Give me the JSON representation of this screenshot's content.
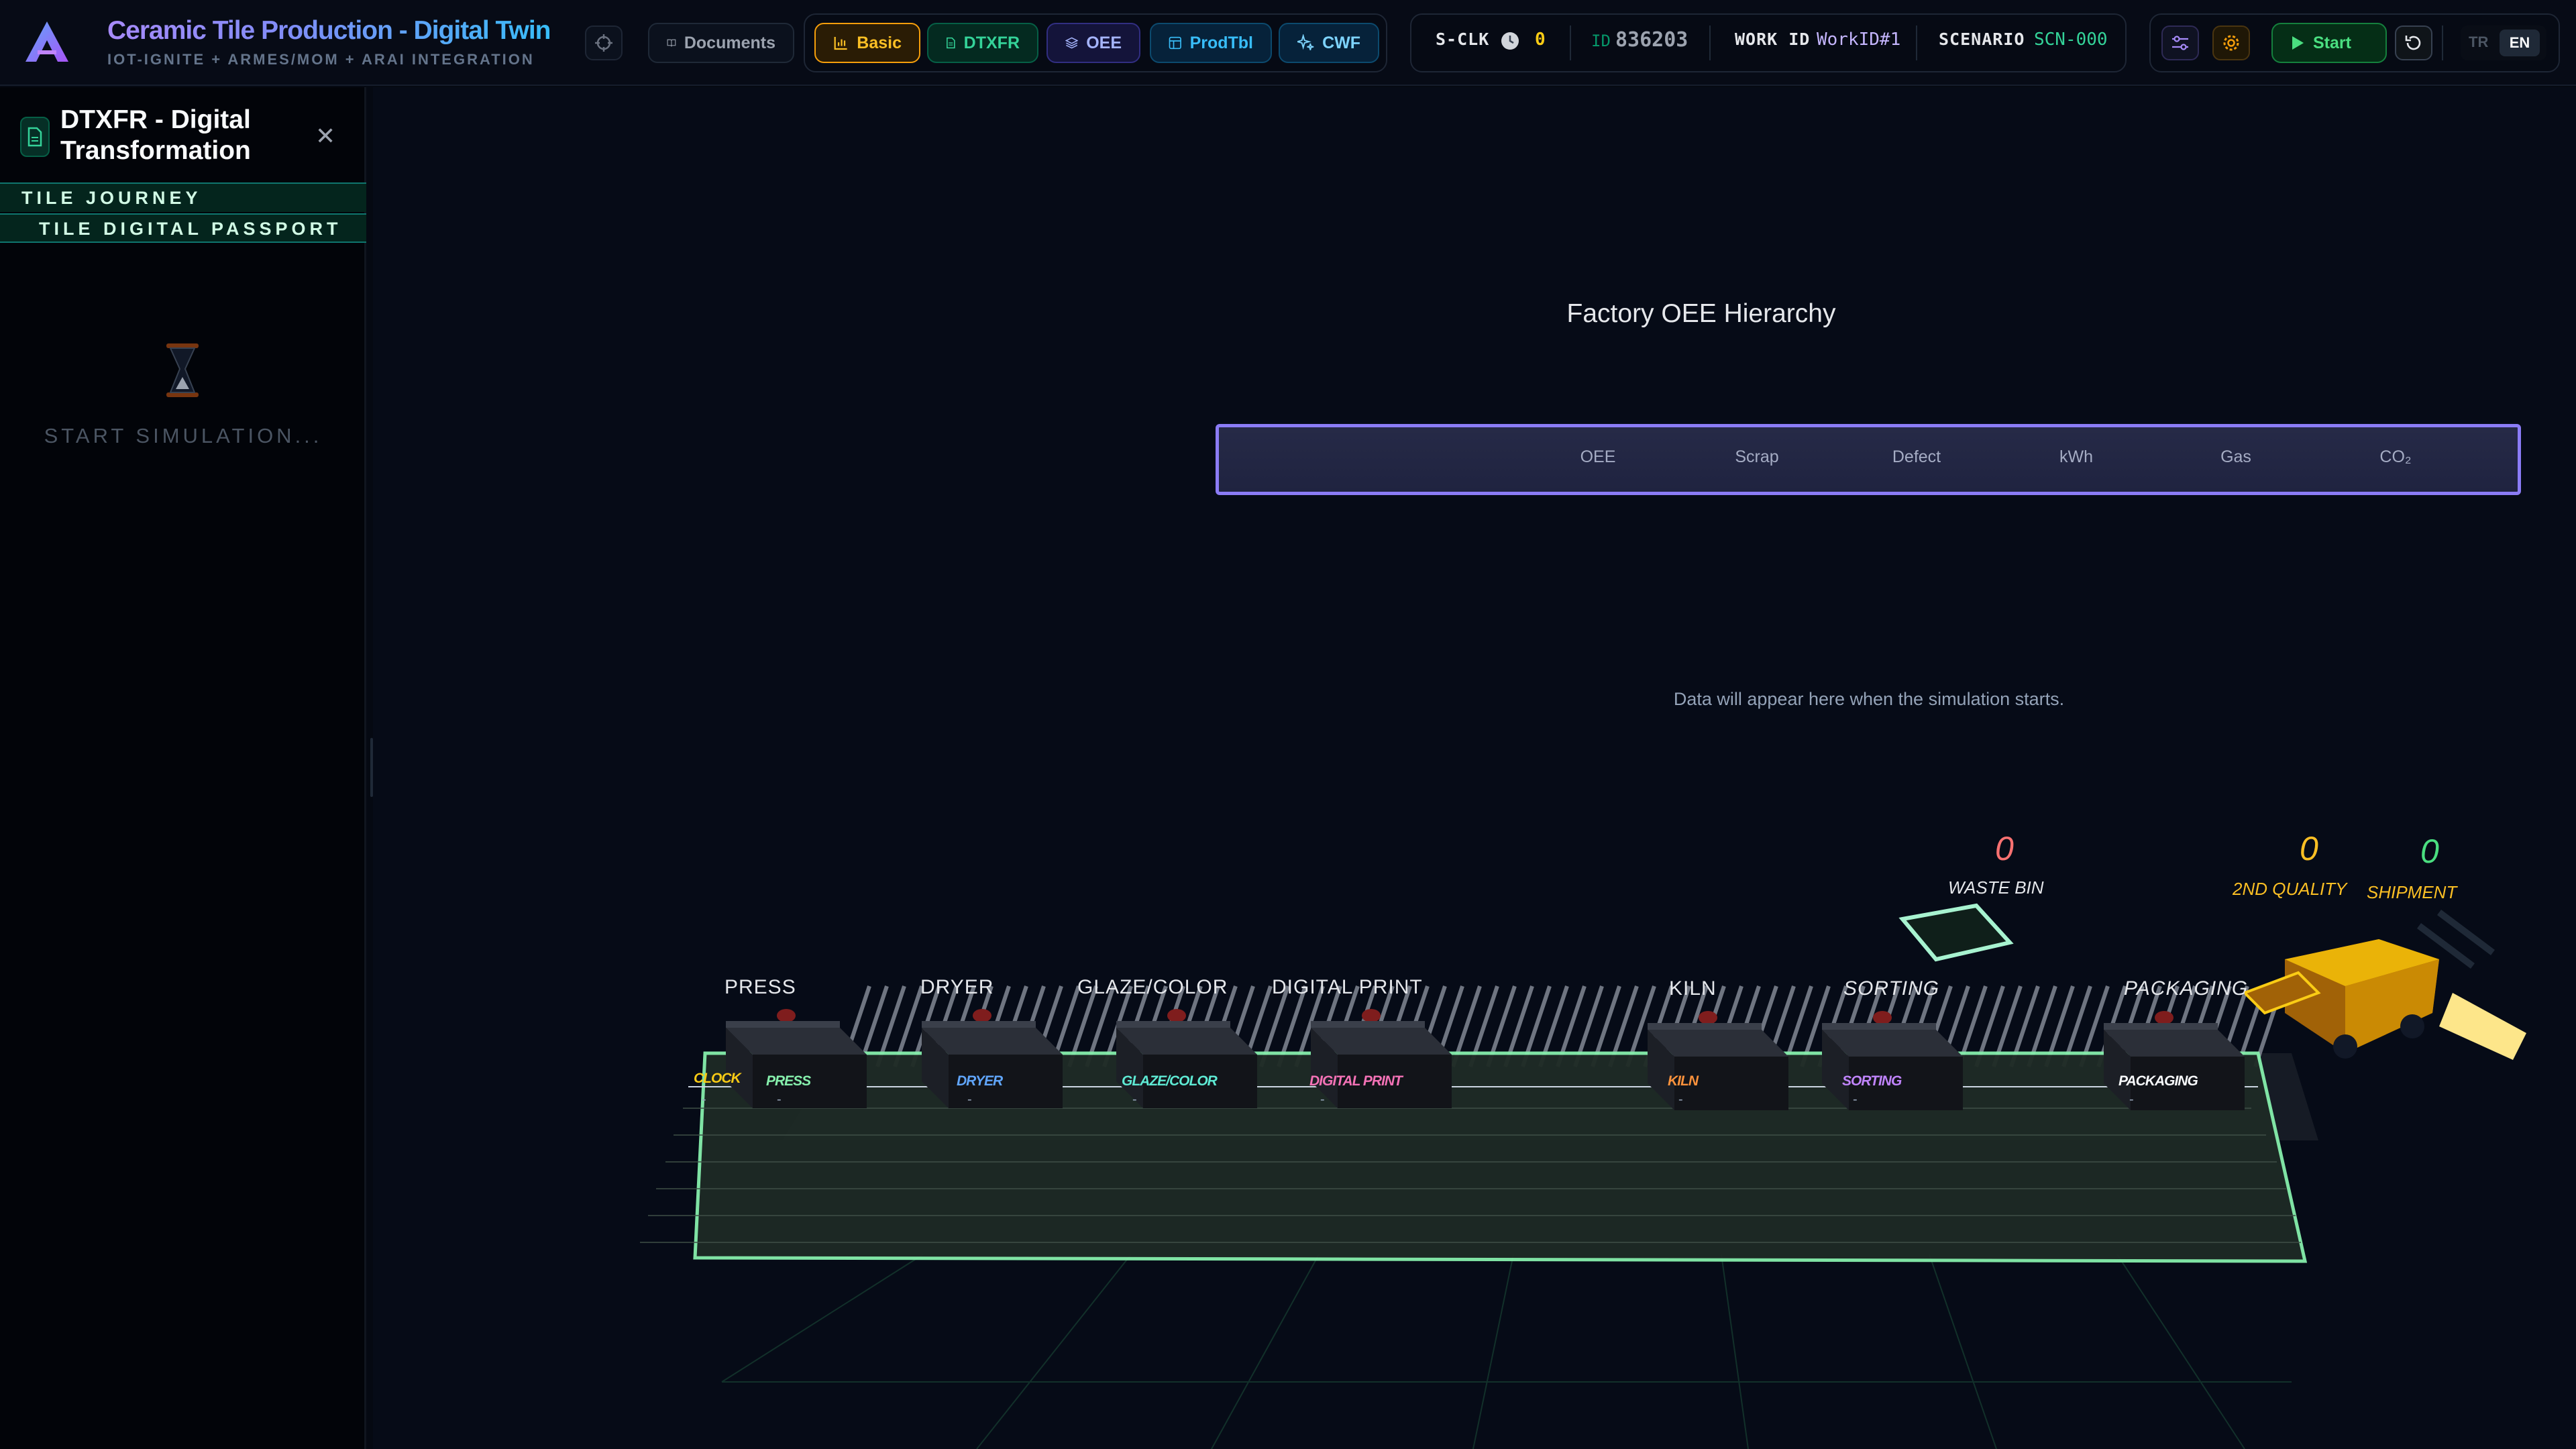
{
  "header": {
    "title": "Ceramic Tile Production - Digital Twin",
    "subtitle": "IOT-IGNITE + ARMES/MOM + ARAI INTEGRATION",
    "documents_label": "Documents",
    "nav": [
      {
        "label": "Basic",
        "icon": "bar-chart-icon",
        "color": "#f59e0b"
      },
      {
        "label": "DTXFR",
        "icon": "document-icon",
        "color": "#34d399"
      },
      {
        "label": "OEE",
        "icon": "layers-icon",
        "color": "#818cf8"
      },
      {
        "label": "ProdTbl",
        "icon": "table-icon",
        "color": "#38bdf8"
      },
      {
        "label": "CWF",
        "icon": "sparkle-icon",
        "color": "#38bdf8"
      }
    ],
    "sclk_label": "S-CLK",
    "sclk_value": "0",
    "id_label": "ID",
    "id_value": "836203",
    "work_id_label": "WORK ID",
    "work_id_value": "WorkID#1",
    "scenario_label": "SCENARIO",
    "scenario_value": "SCN-000",
    "start_label": "Start",
    "lang_options": [
      "TR",
      "EN"
    ],
    "lang_selected": "EN"
  },
  "sidebar": {
    "title": "DTXFR - Digital Transformation",
    "tabs": [
      "TILE JOURNEY",
      "TILE DIGITAL PASSPORT"
    ],
    "loading_text": "START SIMULATION..."
  },
  "oee": {
    "title": "Factory OEE Hierarchy",
    "columns": [
      "OEE",
      "Scrap",
      "Defect",
      "kWh",
      "Gas",
      "CO₂"
    ]
  },
  "scene": {
    "empty_message": "Data will appear here when the simulation starts.",
    "counters": [
      {
        "value": "0",
        "label": "WASTE BIN",
        "color": "#f87171"
      },
      {
        "value": "0",
        "label": "2ND QUALITY",
        "color": "#fbbf24"
      },
      {
        "value": "0",
        "label": "SHIPMENT",
        "color": "#4ade80"
      }
    ],
    "machines": [
      "PRESS",
      "DRYER",
      "GLAZE/COLOR",
      "DIGITAL PRINT",
      "KILN",
      "SORTING",
      "PACKAGING"
    ],
    "board": {
      "clock_label": "CLOCK",
      "headers": [
        {
          "label": "PRESS",
          "color": "#86efac"
        },
        {
          "label": "DRYER",
          "color": "#60a5fa"
        },
        {
          "label": "GLAZE/COLOR",
          "color": "#5eead4"
        },
        {
          "label": "DIGITAL PRINT",
          "color": "#f472b6"
        },
        {
          "label": "KILN",
          "color": "#fb923c"
        },
        {
          "label": "SORTING",
          "color": "#c084fc"
        },
        {
          "label": "PACKAGING",
          "color": "#f8fafc"
        }
      ],
      "empty_cell": "-"
    }
  }
}
